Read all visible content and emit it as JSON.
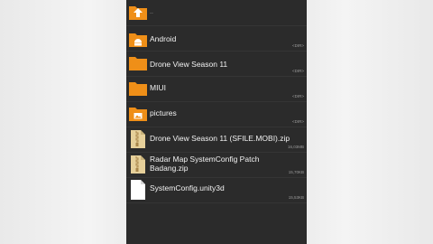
{
  "file_list": {
    "up_entry": {
      "label": "..",
      "icon": "folder-up-icon"
    },
    "items": [
      {
        "name": "Android",
        "meta": "<DIR>",
        "icon": "android-folder-icon"
      },
      {
        "name": "Drone View Season 11",
        "meta": "<DIR>",
        "icon": "folder-icon"
      },
      {
        "name": "MIUI",
        "meta": "<DIR>",
        "icon": "folder-icon"
      },
      {
        "name": "pictures",
        "meta": "<DIR>",
        "icon": "image-folder-icon"
      },
      {
        "name": "Drone View Season 11 (SFILE.MOBI).zip",
        "meta": "16,03MB",
        "icon": "zip-file-icon"
      },
      {
        "name_line1": "Radar Map SystemConfig Patch",
        "name_line2": "Badang.zip",
        "meta": "15,70KB",
        "icon": "zip-file-icon"
      },
      {
        "name": "SystemConfig.unity3d",
        "meta": "15,53KB",
        "icon": "file-icon"
      }
    ]
  },
  "colors": {
    "folder": "#ef8f18",
    "zip": "#e6d09a",
    "list_bg": "#2b2b2b",
    "text": "#f2f2f2"
  }
}
